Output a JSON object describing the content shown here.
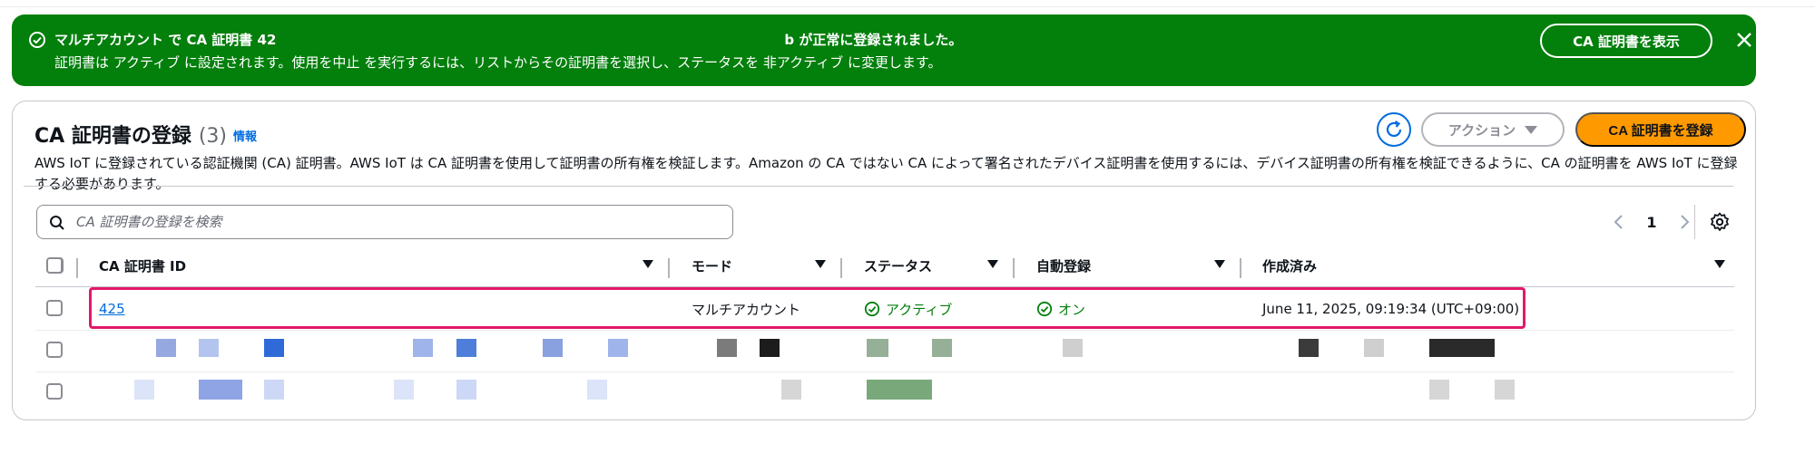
{
  "flash": {
    "title_prefix": "マルチアカウント で CA 証明書 42",
    "title_suffix": "b が正常に登録されました。",
    "message": "証明書は アクティブ に設定されます。使用を中止 を実行するには、リストからその証明書を選択し、ステータスを 非アクティブ に変更します。",
    "view_button": "CA 証明書を表示",
    "colors": {
      "background": "#037f0c"
    }
  },
  "header": {
    "title": "CA 証明書の登録",
    "count": "(3)",
    "info_link": "情報",
    "description": "AWS IoT に登録されている認証機関 (CA) 証明書。AWS IoT は CA 証明書を使用して証明書の所有権を検証します。Amazon の CA ではない CA によって署名されたデバイス証明書を使用するには、デバイス証明書の所有権を検証できるように、CA の証明書を AWS IoT に登録する必要があります。",
    "action_button": "アクション",
    "register_button": "CA 証明書を登録",
    "colors": {
      "primary": "#ff9900",
      "link": "#006ce0"
    }
  },
  "search": {
    "placeholder": "CA 証明書の登録を検索"
  },
  "pagination": {
    "current_page": "1"
  },
  "table": {
    "columns": [
      "CA 証明書 ID",
      "モード",
      "ステータス",
      "自動登録",
      "作成済み"
    ],
    "rows": [
      {
        "id": "425",
        "mode": "マルチアカウント",
        "status": "アクティブ",
        "auto_registration": "オン",
        "created": "June 11, 2025, 09:19:34 (UTC+09:00)"
      }
    ]
  },
  "icons": [
    "check-circle-icon",
    "close-icon",
    "refresh-icon",
    "caret-down-icon",
    "search-icon",
    "chevron-left-icon",
    "chevron-right-icon",
    "settings-gear-icon"
  ]
}
